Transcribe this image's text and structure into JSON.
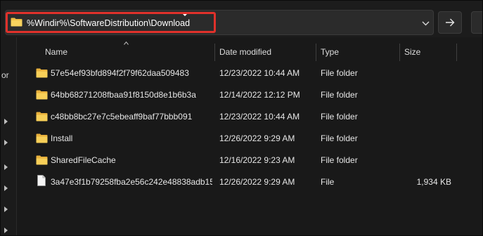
{
  "address_bar": {
    "path": "%Windir%\\SoftwareDistribution\\Download",
    "dropdown_icon": "chevron-down-icon",
    "go_icon": "arrow-right-icon"
  },
  "nav_pane": {
    "partial_label": "or"
  },
  "columns": {
    "name": "Name",
    "date_modified": "Date modified",
    "type": "Type",
    "size": "Size"
  },
  "files": [
    {
      "name": "57e54ef93bfd894f2f79f62daa509483",
      "date": "12/23/2022 10:44 AM",
      "type": "File folder",
      "size": "",
      "icon": "folder-icon"
    },
    {
      "name": "64bb68271208fbaa91f8150d8e1b6b3a",
      "date": "12/14/2022 12:12 PM",
      "type": "File folder",
      "size": "",
      "icon": "folder-icon"
    },
    {
      "name": "c48bb8bc27e7c5ebeaff9baf77bbb091",
      "date": "12/23/2022 10:44 AM",
      "type": "File folder",
      "size": "",
      "icon": "folder-icon"
    },
    {
      "name": "Install",
      "date": "12/26/2022 9:29 AM",
      "type": "File folder",
      "size": "",
      "icon": "folder-icon"
    },
    {
      "name": "SharedFileCache",
      "date": "12/16/2022 9:23 AM",
      "type": "File folder",
      "size": "",
      "icon": "folder-icon"
    },
    {
      "name": "3a47e3f1b79258fba2e56c242e48838adb15...",
      "date": "12/26/2022 9:29 AM",
      "type": "File",
      "size": "1,934 KB",
      "icon": "file-icon"
    }
  ],
  "colors": {
    "highlight": "#e0312b",
    "folder": "#f2c14e",
    "background": "#191919"
  }
}
